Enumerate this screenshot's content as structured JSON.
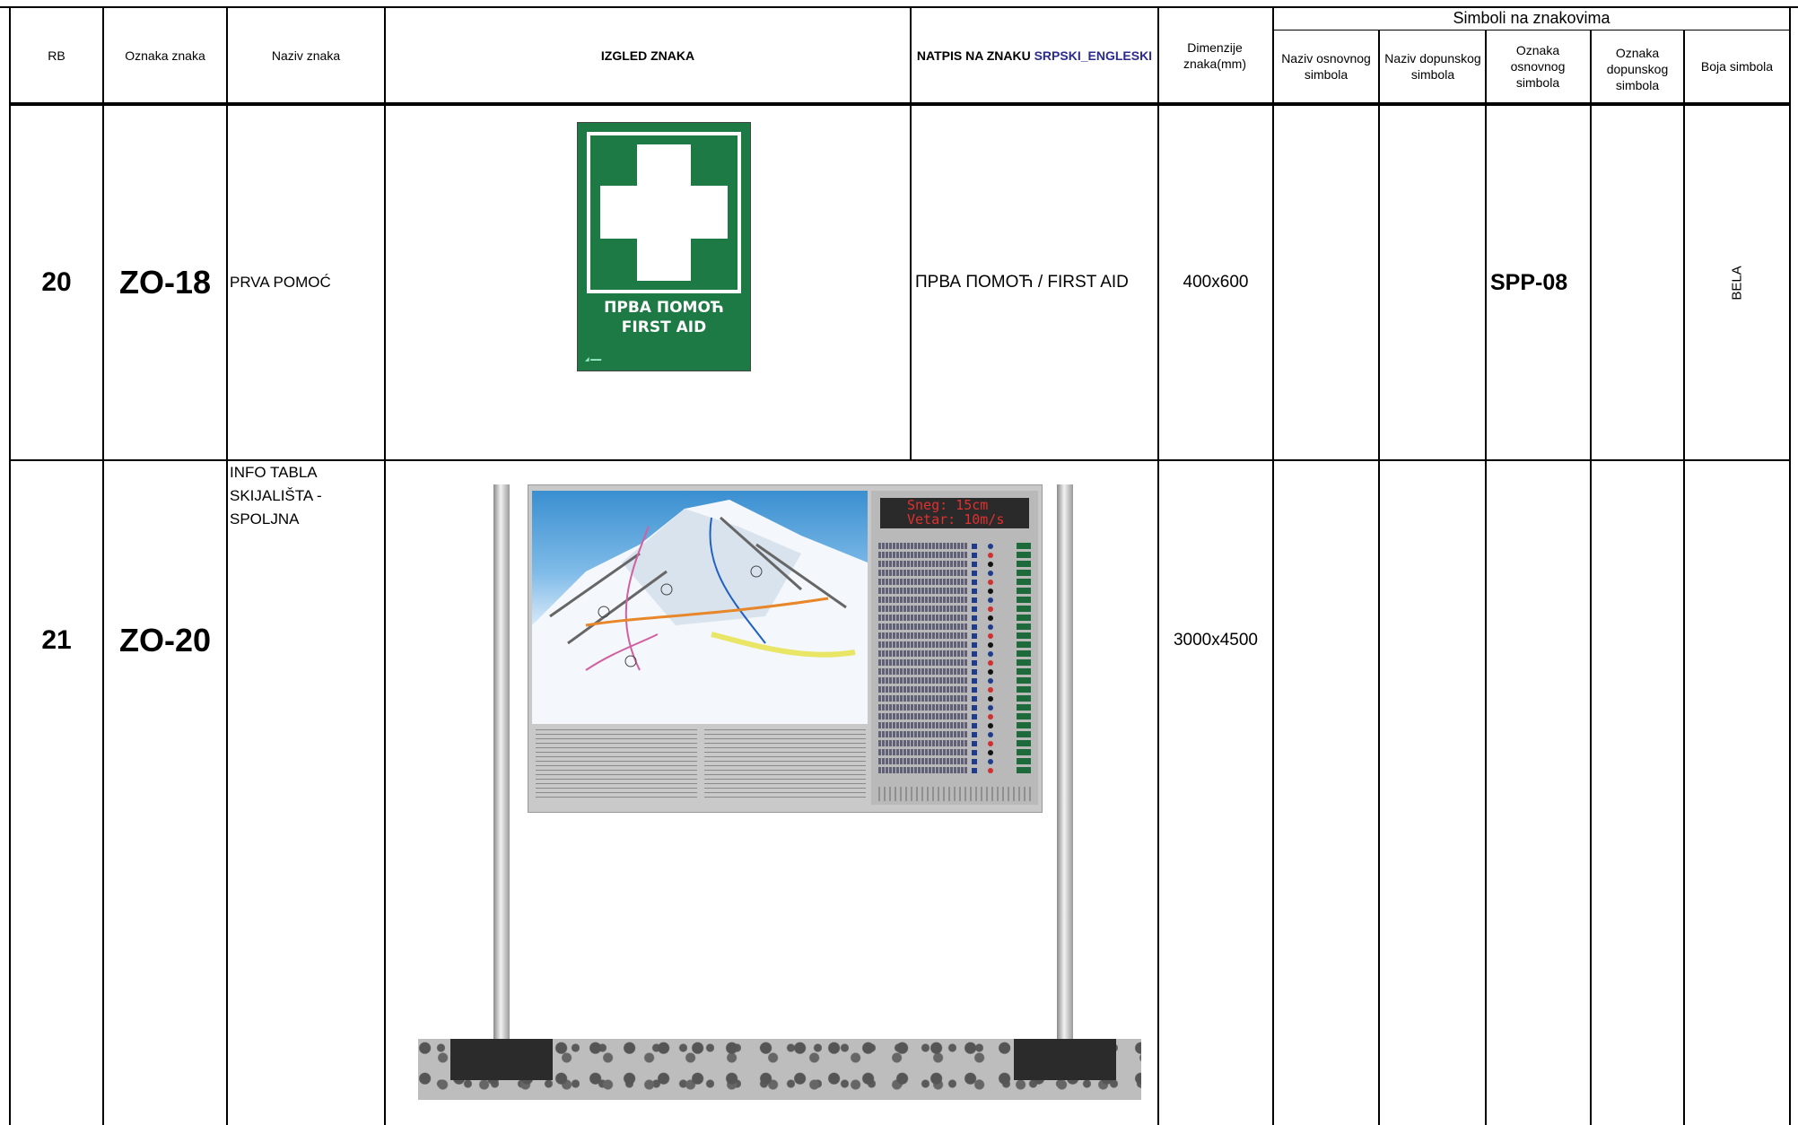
{
  "header": {
    "rb": "RB",
    "oznaka_znaka": "Oznaka znaka",
    "naziv_znaka": "Naziv znaka",
    "izgled_znaka": "IZGLED ZNAKA",
    "natpis_prefix": "NATPIS NA ZNAKU",
    "natpis_suffix": "SRPSKI_ENGLESKI",
    "dimenzije": "Dimenzije znaka(mm)",
    "simboli_group": "Simboli na znakovima",
    "naziv_osnovnog": "Naziv osnovnog simbola",
    "naziv_dopunskog": "Naziv dopunskog simbola",
    "oznaka_osnovnog": "Oznaka osnovnog simbola",
    "oznaka_dopunskog": "Oznaka dopunskog simbola",
    "boja_simbola": "Boja simbola"
  },
  "rows": [
    {
      "rb": "20",
      "oznaka": "ZO-18",
      "naziv": "PRVA POMOĆ",
      "natpis": "ПРВА ПОМОЋ / FIRST AID",
      "dimenzije": "400x600",
      "naziv_osnovnog": "",
      "naziv_dopunskog": "",
      "oznaka_osnovnog": "SPP-08",
      "oznaka_dopunskog": "",
      "boja": "BELA",
      "sign": {
        "line1": "ПРВА ПОМОЋ",
        "line2": "FIRST AID",
        "bg_color": "#1d7a45",
        "icon": "cross-icon"
      }
    },
    {
      "rb": "21",
      "oznaka": "ZO-20",
      "naziv_lines": [
        "INFO TABLA",
        "SKIJALIŠTA -",
        "SPOLJNA"
      ],
      "natpis": "",
      "dimenzije": "3000x4500",
      "naziv_osnovnog": "",
      "naziv_dopunskog": "",
      "oznaka_osnovnog": "",
      "oznaka_dopunskog": "",
      "boja": "",
      "board": {
        "led_line1": "Sneg: 15cm",
        "led_line2": "Vetar: 10m/s",
        "run_count": 26
      }
    }
  ]
}
